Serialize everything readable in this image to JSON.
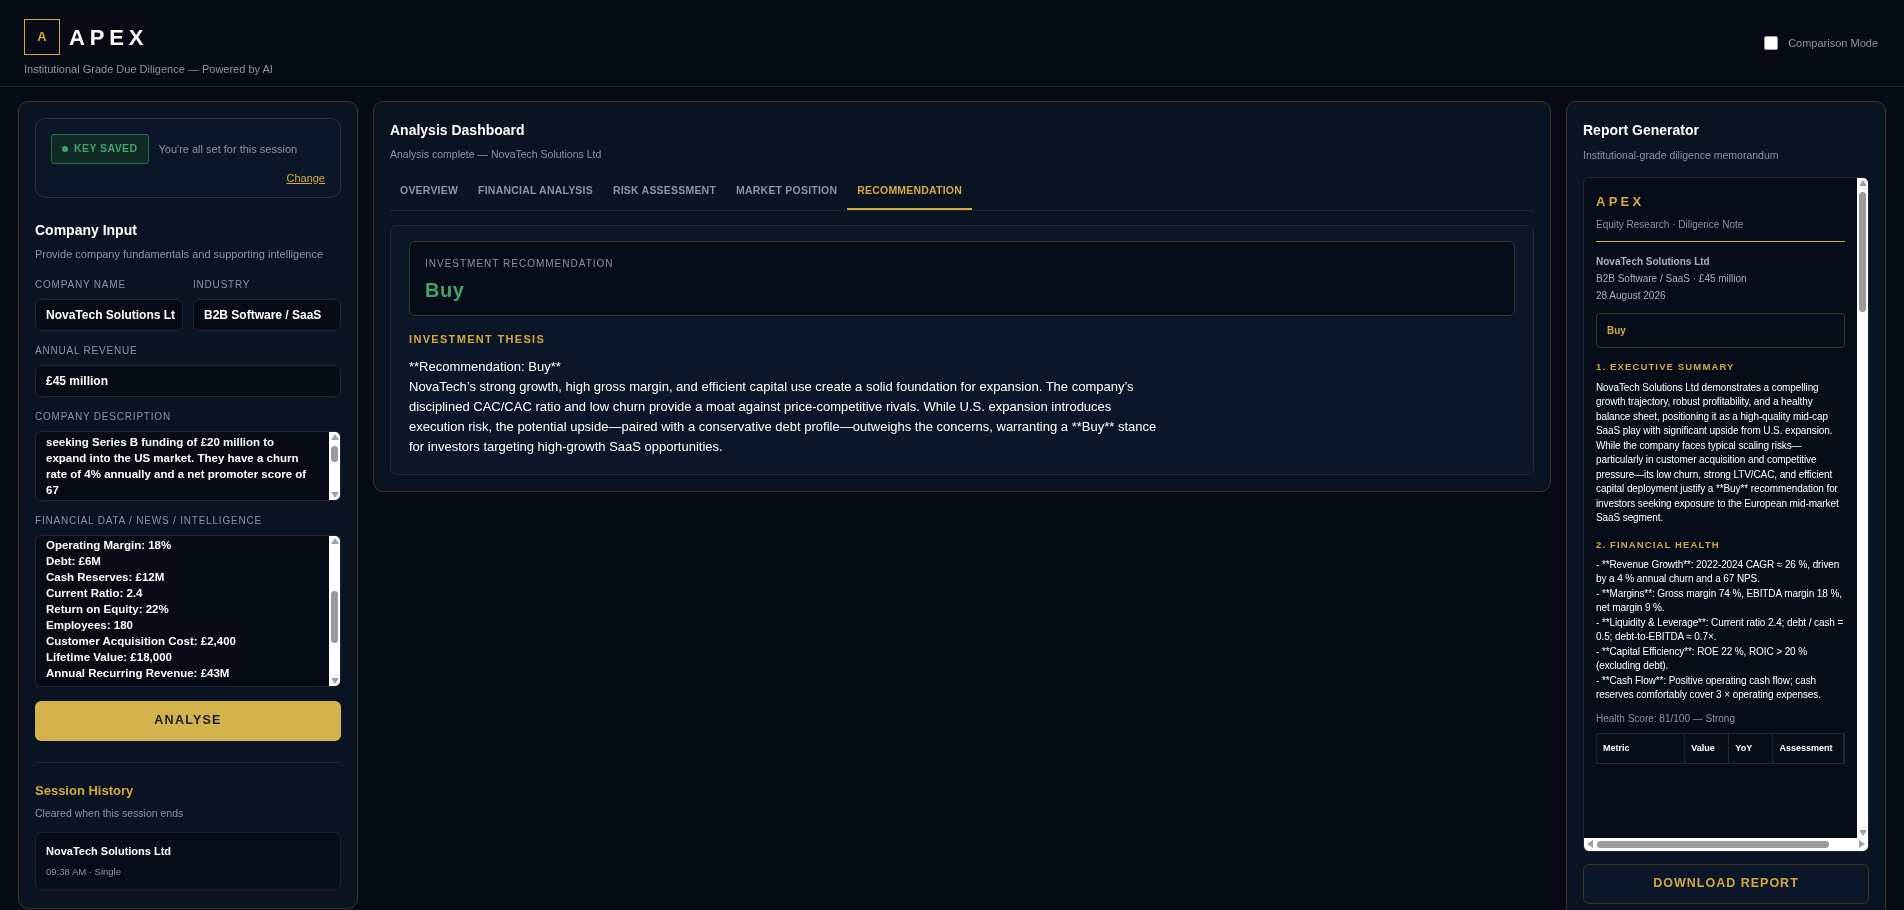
{
  "header": {
    "logo_letter": "A",
    "brand": "APEX",
    "tagline": "Institutional Grade Due Diligence — Powered by AI",
    "comparison_mode": {
      "label": "Comparison Mode",
      "checked": false
    }
  },
  "input_panel": {
    "key_status": {
      "badge": "KEY SAVED",
      "message": "You're all set for this session",
      "change_link": "Change"
    },
    "title": "Company Input",
    "subtitle": "Provide company fundamentals and supporting intelligence",
    "fields": [
      {
        "label": "COMPANY NAME",
        "value": "NovaTech Solutions Lt"
      },
      {
        "label": "INDUSTRY",
        "value": "B2B Software / SaaS"
      },
      {
        "label": "ANNUAL REVENUE",
        "value": "£45 million"
      }
    ],
    "description": {
      "label": "COMPANY DESCRIPTION",
      "lines": [
        "seeking Series B funding of £20 million to",
        "expand into the US market. They have a churn",
        "rate of 4% annually and a net promoter score of",
        "67"
      ]
    },
    "financial_data": {
      "label": "FINANCIAL DATA / NEWS / INTELLIGENCE",
      "lines": [
        "Operating Margin: 18%",
        "Debt: £6M",
        "Cash Reserves: £12M",
        "Current Ratio: 2.4",
        "Return on Equity: 22%",
        "Employees: 180",
        "Customer Acquisition Cost: £2,400",
        "Lifetime Value: £18,000",
        "Annual Recurring Revenue: £43M"
      ]
    },
    "analyse_button": "ANALYSE",
    "session_history": {
      "title": "Session History",
      "subtitle": "Cleared when this session ends",
      "items": [
        {
          "name": "NovaTech Solutions Ltd",
          "meta": "09:38 AM · Single"
        }
      ]
    }
  },
  "dashboard": {
    "title": "Analysis Dashboard",
    "subtitle": "Analysis complete — NovaTech Solutions Ltd",
    "tabs": [
      {
        "label": "OVERVIEW",
        "selected": false
      },
      {
        "label": "FINANCIAL ANALYSIS",
        "selected": false
      },
      {
        "label": "RISK ASSESSMENT",
        "selected": false
      },
      {
        "label": "MARKET POSITION",
        "selected": false
      },
      {
        "label": "RECOMMENDATION",
        "selected": true
      }
    ],
    "recommendation": {
      "label": "INVESTMENT RECOMMENDATION",
      "value": "Buy"
    },
    "thesis": {
      "heading": "INVESTMENT THESIS",
      "lines": [
        "**Recommendation: Buy**",
        "NovaTech’s strong growth, high gross margin, and efficient capital use create a solid foundation for expansion. The company’s disciplined CAC/CAC ratio and low churn provide a moat against price-competitive rivals. While U.S. expansion introduces execution risk, the potential upside—paired with a conservative debt profile—outweighs the concerns, warranting a **Buy** stance for investors targeting high-growth SaaS opportunities."
      ]
    }
  },
  "report_panel": {
    "title": "Report Generator",
    "subtitle": "Institutional-grade diligence memorandum",
    "report": {
      "brand": "APEX",
      "kind_line": "Equity Research · Diligence Note",
      "company": "NovaTech Solutions Ltd",
      "meta": "B2B Software / SaaS · £45 million",
      "date": "28 August 2026",
      "rating": "Buy",
      "sections": [
        {
          "heading": "1. EXECUTIVE SUMMARY",
          "lines": [
            "NovaTech Solutions Ltd demonstrates a compelling growth trajectory, robust profitability, and a healthy balance sheet, positioning it as a high-quality mid-cap SaaS play with significant upside from U.S. expansion. While the company faces typical scaling risks—particularly in customer acquisition and competitive pressure—its low churn, strong LTV/CAC, and efficient capital deployment justify a **Buy** recommendation for investors seeking exposure to the European mid-market SaaS segment."
          ]
        },
        {
          "heading": "2. FINANCIAL HEALTH",
          "lines": [
            "- **Revenue Growth**: 2022-2024 CAGR ≈ 26 %, driven by a 4 % annual churn and a 67 NPS.",
            "- **Margins**: Gross margin 74 %, EBITDA margin 18 %, net margin 9 %.",
            "- **Liquidity & Leverage**: Current ratio 2.4; debt / cash = 0.5; debt-to-EBITDA ≈ 0.7×.",
            "- **Capital Efficiency**: ROE 22 %, ROIC > 20 % (excluding debt).",
            "- **Cash Flow**: Positive operating cash flow; cash reserves comfortably cover 3 × operating expenses."
          ]
        }
      ],
      "health_score": "Health Score: 81/100 — Strong",
      "table_columns": [
        "Metric",
        "Value",
        "YoY",
        "Assessment"
      ]
    },
    "download_button": "DOWNLOAD REPORT"
  }
}
